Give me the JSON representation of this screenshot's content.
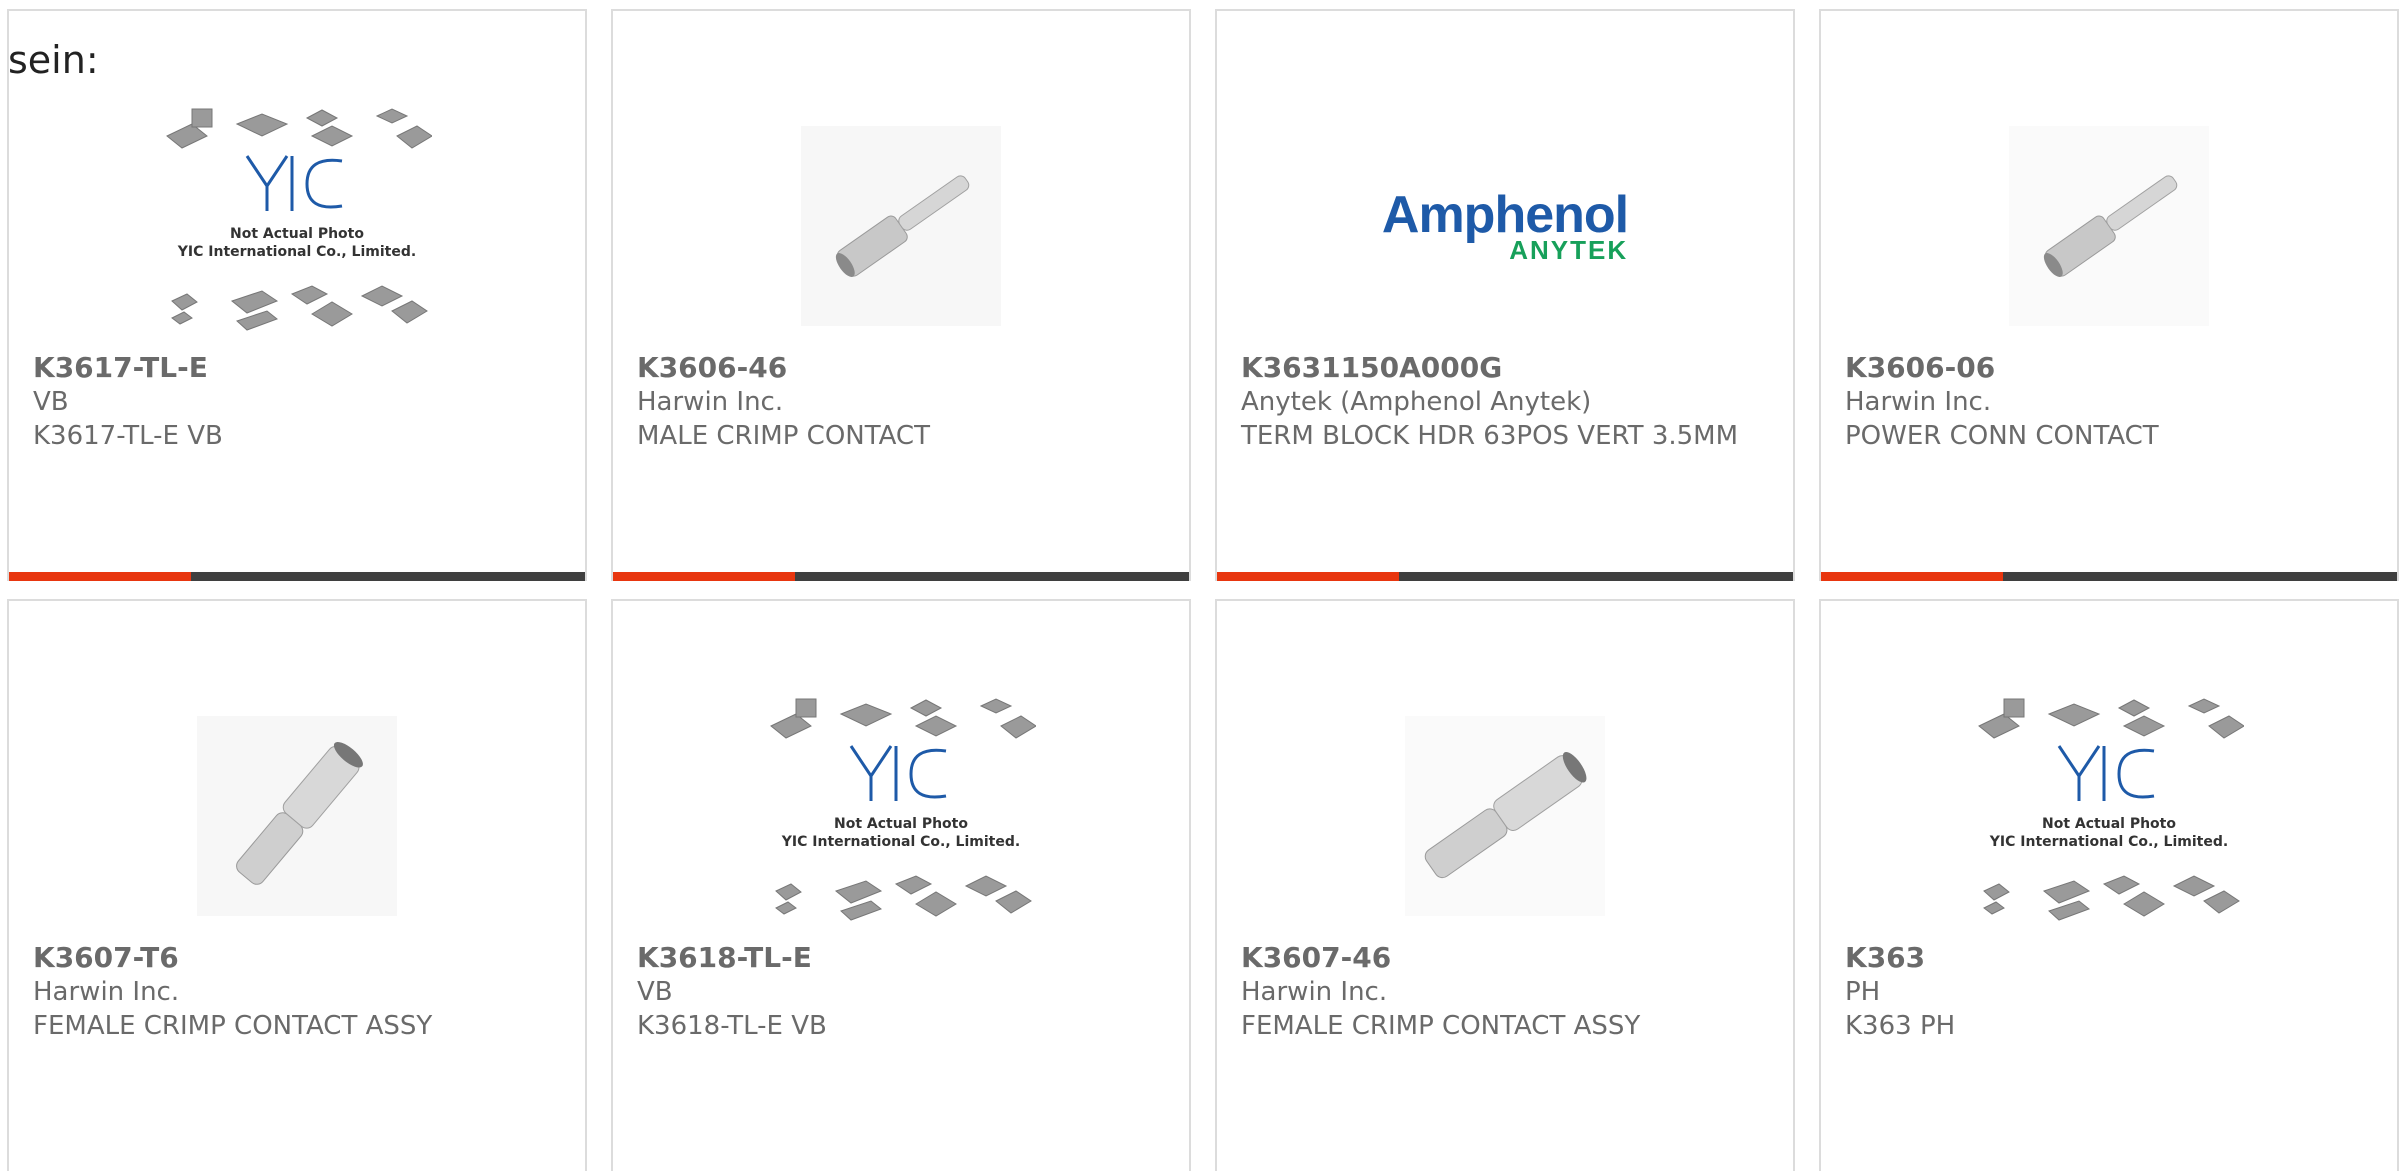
{
  "intro_text": "sein:",
  "placeholder": {
    "line1": "Not Actual Photo",
    "line2": "YIC International Co., Limited."
  },
  "logo": {
    "line1": "Amphenol",
    "line2": "ANYTEK"
  },
  "colors": {
    "accent": "#e8360f",
    "bar": "#3f3f3f",
    "border": "#dcdcdc",
    "text": "#6a6a6a"
  },
  "products": [
    {
      "part": "K3617-TL-E",
      "maker": "VB",
      "desc": "K3617-TL-E VB",
      "image": "yic-placeholder-image"
    },
    {
      "part": "K3606-46",
      "maker": "Harwin Inc.",
      "desc": "MALE CRIMP CONTACT",
      "image": "crimp-pin-image"
    },
    {
      "part": "K3631150A000G",
      "maker": "Anytek (Amphenol Anytek)",
      "desc": "TERM BLOCK HDR 63POS VERT 3.5MM",
      "image": "amphenol-logo-image"
    },
    {
      "part": "K3606-06",
      "maker": "Harwin Inc.",
      "desc": "POWER CONN CONTACT",
      "image": "crimp-pin-image"
    },
    {
      "part": "K3607-T6",
      "maker": "Harwin Inc.",
      "desc": "FEMALE CRIMP CONTACT ASSY",
      "image": "crimp-socket-image"
    },
    {
      "part": "K3618-TL-E",
      "maker": "VB",
      "desc": "K3618-TL-E VB",
      "image": "yic-placeholder-image"
    },
    {
      "part": "K3607-46",
      "maker": "Harwin Inc.",
      "desc": "FEMALE CRIMP CONTACT ASSY",
      "image": "crimp-socket-image"
    },
    {
      "part": "K363",
      "maker": "PH",
      "desc": "K363 PH",
      "image": "yic-placeholder-image"
    }
  ]
}
